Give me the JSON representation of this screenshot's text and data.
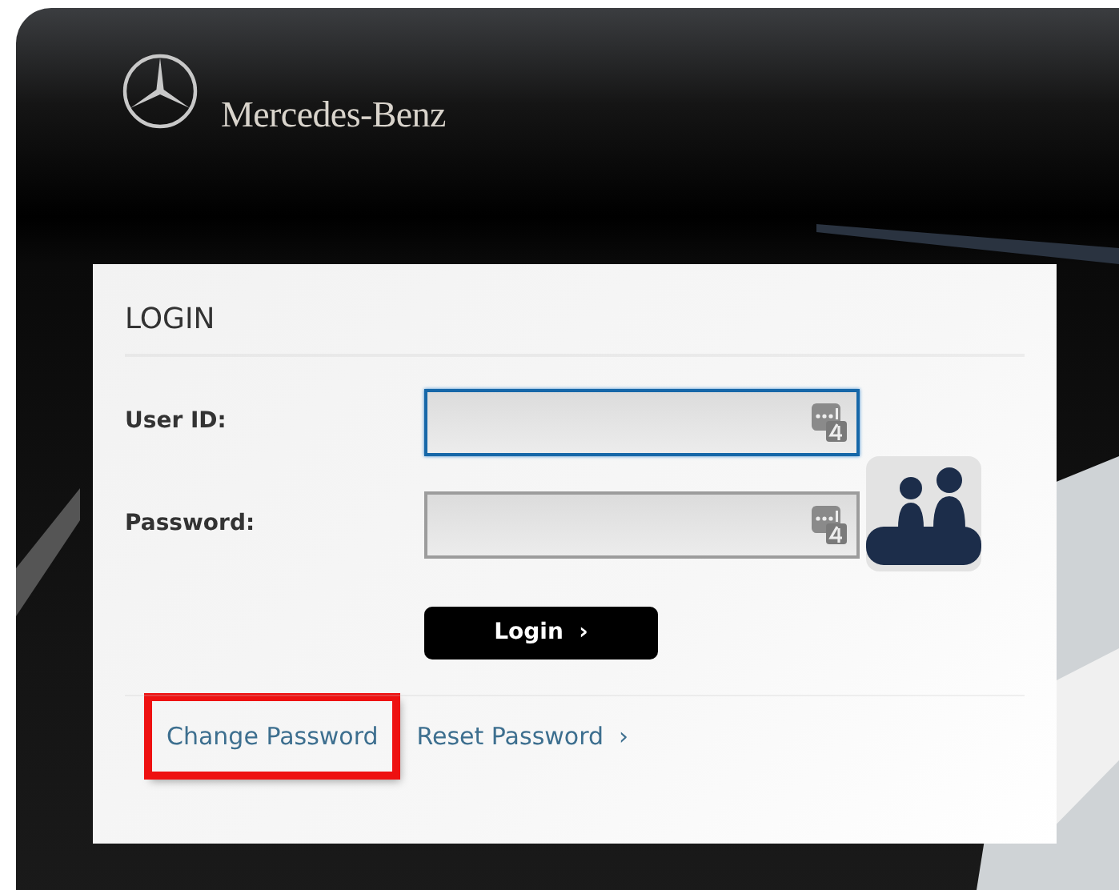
{
  "header": {
    "brand": "Mercedes-Benz"
  },
  "login": {
    "title": "LOGIN",
    "fields": [
      {
        "label": "User ID:",
        "focused": true
      },
      {
        "label": "Password:",
        "focused": false
      }
    ],
    "button": {
      "label": "Login",
      "chevron": "›"
    },
    "links": [
      {
        "label": "Change Password",
        "highlighted": true
      },
      {
        "label": "Reset Password",
        "highlighted": false,
        "chevron": "›"
      }
    ]
  }
}
